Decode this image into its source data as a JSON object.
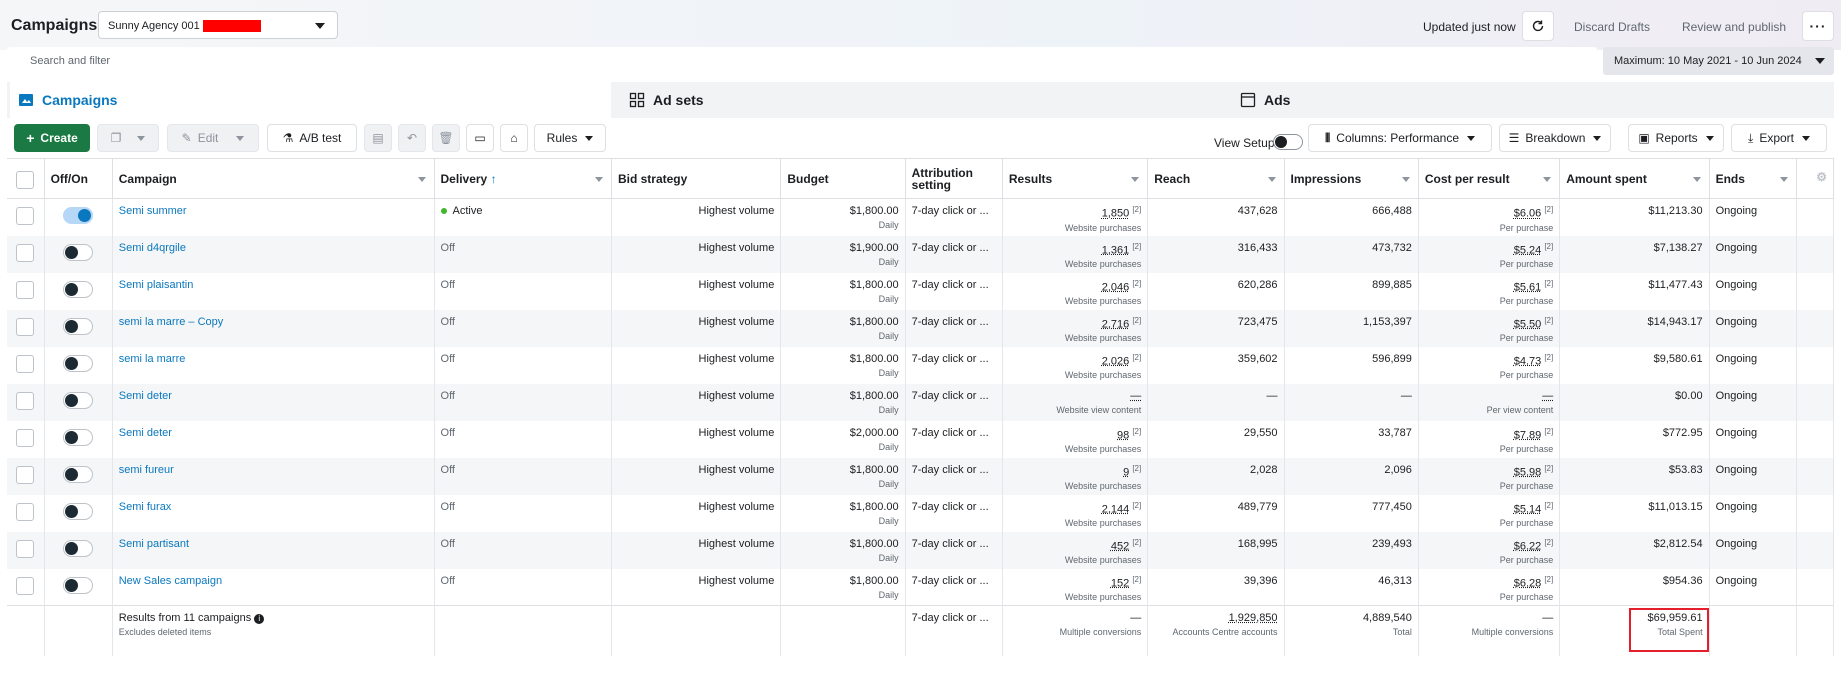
{
  "header": {
    "title": "Campaigns",
    "account": "Sunny Agency 001",
    "updated": "Updated just now",
    "discard": "Discard Drafts",
    "review": "Review and publish"
  },
  "search": {
    "placeholder": "Search and filter"
  },
  "date_range": "Maximum: 10 May 2021 - 10 Jun 2024",
  "tabs": [
    {
      "label": "Campaigns",
      "active": true
    },
    {
      "label": "Ad sets",
      "active": false
    },
    {
      "label": "Ads",
      "active": false
    }
  ],
  "toolbar": {
    "create": "Create",
    "edit": "Edit",
    "ab_test": "A/B test",
    "rules": "Rules",
    "view_setup": "View Setup",
    "columns": "Columns: Performance",
    "breakdown": "Breakdown",
    "reports": "Reports",
    "export": "Export"
  },
  "columns": [
    "Off/On",
    "Campaign",
    "Delivery",
    "Bid strategy",
    "Budget",
    "Attribution setting",
    "Results",
    "Reach",
    "Impressions",
    "Cost per result",
    "Amount spent",
    "Ends"
  ],
  "rows": [
    {
      "name": "Semi summer",
      "on": true,
      "delivery": "Active",
      "bid": "Highest volume",
      "budget": "$1,800.00",
      "budget_sub": "Daily",
      "attribution": "7-day click or ...",
      "results": "1,850",
      "results_sub": "Website purchases",
      "reach": "437,628",
      "impressions": "666,488",
      "cpr": "$6.06",
      "cpr_sub": "Per purchase",
      "spent": "$11,213.30",
      "ends": "Ongoing"
    },
    {
      "name": "Semi d4qrgile",
      "on": false,
      "delivery": "Off",
      "bid": "Highest volume",
      "budget": "$1,900.00",
      "budget_sub": "Daily",
      "attribution": "7-day click or ...",
      "results": "1,361",
      "results_sub": "Website purchases",
      "reach": "316,433",
      "impressions": "473,732",
      "cpr": "$5.24",
      "cpr_sub": "Per purchase",
      "spent": "$7,138.27",
      "ends": "Ongoing"
    },
    {
      "name": "Semi plaisantin",
      "on": false,
      "delivery": "Off",
      "bid": "Highest volume",
      "budget": "$1,800.00",
      "budget_sub": "Daily",
      "attribution": "7-day click or ...",
      "results": "2,046",
      "results_sub": "Website purchases",
      "reach": "620,286",
      "impressions": "899,885",
      "cpr": "$5.61",
      "cpr_sub": "Per purchase",
      "spent": "$11,477.43",
      "ends": "Ongoing"
    },
    {
      "name": "semi la marre – Copy",
      "on": false,
      "delivery": "Off",
      "bid": "Highest volume",
      "budget": "$1,800.00",
      "budget_sub": "Daily",
      "attribution": "7-day click or ...",
      "results": "2,716",
      "results_sub": "Website purchases",
      "reach": "723,475",
      "impressions": "1,153,397",
      "cpr": "$5.50",
      "cpr_sub": "Per purchase",
      "spent": "$14,943.17",
      "ends": "Ongoing"
    },
    {
      "name": "semi la marre",
      "on": false,
      "delivery": "Off",
      "bid": "Highest volume",
      "budget": "$1,800.00",
      "budget_sub": "Daily",
      "attribution": "7-day click or ...",
      "results": "2,026",
      "results_sub": "Website purchases",
      "reach": "359,602",
      "impressions": "596,899",
      "cpr": "$4.73",
      "cpr_sub": "Per purchase",
      "spent": "$9,580.61",
      "ends": "Ongoing"
    },
    {
      "name": "Semi deter",
      "on": false,
      "delivery": "Off",
      "bid": "Highest volume",
      "budget": "$1,800.00",
      "budget_sub": "Daily",
      "attribution": "7-day click or ...",
      "results": "—",
      "results_sub": "Website view content",
      "reach": "—",
      "impressions": "—",
      "cpr": "—",
      "cpr_sub": "Per view content",
      "spent": "$0.00",
      "ends": "Ongoing"
    },
    {
      "name": "Semi deter",
      "on": false,
      "delivery": "Off",
      "bid": "Highest volume",
      "budget": "$2,000.00",
      "budget_sub": "Daily",
      "attribution": "7-day click or ...",
      "results": "98",
      "results_sub": "Website purchases",
      "reach": "29,550",
      "impressions": "33,787",
      "cpr": "$7.89",
      "cpr_sub": "Per purchase",
      "spent": "$772.95",
      "ends": "Ongoing"
    },
    {
      "name": "semi fureur",
      "on": false,
      "delivery": "Off",
      "bid": "Highest volume",
      "budget": "$1,800.00",
      "budget_sub": "Daily",
      "attribution": "7-day click or ...",
      "results": "9",
      "results_sub": "Website purchases",
      "reach": "2,028",
      "impressions": "2,096",
      "cpr": "$5.98",
      "cpr_sub": "Per purchase",
      "spent": "$53.83",
      "ends": "Ongoing"
    },
    {
      "name": "Semi furax",
      "on": false,
      "delivery": "Off",
      "bid": "Highest volume",
      "budget": "$1,800.00",
      "budget_sub": "Daily",
      "attribution": "7-day click or ...",
      "results": "2,144",
      "results_sub": "Website purchases",
      "reach": "489,779",
      "impressions": "777,450",
      "cpr": "$5.14",
      "cpr_sub": "Per purchase",
      "spent": "$11,013.15",
      "ends": "Ongoing"
    },
    {
      "name": "Semi partisant",
      "on": false,
      "delivery": "Off",
      "bid": "Highest volume",
      "budget": "$1,800.00",
      "budget_sub": "Daily",
      "attribution": "7-day click or ...",
      "results": "452",
      "results_sub": "Website purchases",
      "reach": "168,995",
      "impressions": "239,493",
      "cpr": "$6.22",
      "cpr_sub": "Per purchase",
      "spent": "$2,812.54",
      "ends": "Ongoing"
    },
    {
      "name": "New Sales campaign",
      "on": false,
      "delivery": "Off",
      "bid": "Highest volume",
      "budget": "$1,800.00",
      "budget_sub": "Daily",
      "attribution": "7-day click or ...",
      "results": "152",
      "results_sub": "Website purchases",
      "reach": "39,396",
      "impressions": "46,313",
      "cpr": "$6.28",
      "cpr_sub": "Per purchase",
      "spent": "$954.36",
      "ends": "Ongoing"
    }
  ],
  "totals": {
    "label": "Results from 11 campaigns",
    "sub": "Excludes deleted items",
    "attribution": "7-day click or ...",
    "results": "—",
    "results_sub": "Multiple conversions",
    "reach": "1,929,850",
    "reach_sub": "Accounts Centre accounts",
    "impressions": "4,889,540",
    "impressions_sub": "Total",
    "cpr": "—",
    "cpr_sub": "Multiple conversions",
    "spent": "$69,959.61",
    "spent_sub": "Total Spent"
  },
  "colors": {
    "accent": "#0a78be",
    "create": "#1b7a43",
    "highlight": "#e41e2b"
  }
}
